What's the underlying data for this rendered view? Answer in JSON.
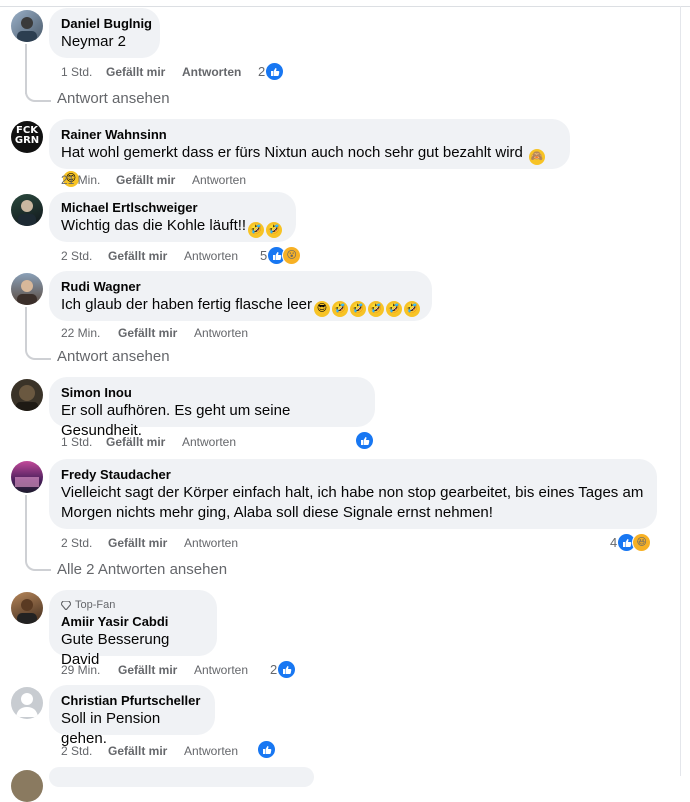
{
  "comments": [
    {
      "name": "Daniel Buglnig",
      "text": "Neymar 2",
      "time": "1 Std.",
      "like": "Gefällt mir",
      "reply": "Antworten",
      "count": "2"
    },
    {
      "name": "Rainer Wahnsinn",
      "text": "Hat wohl gemerkt dass er fürs Nixtun auch noch sehr gut bezahlt wird",
      "time": "21 Min.",
      "like": "Gefällt mir",
      "reply": "Antworten",
      "avatar_text_1": "FCK",
      "avatar_text_2": "GRN"
    },
    {
      "name": "Michael Ertlschweiger",
      "text": "Wichtig das die Kohle läuft!!",
      "time": "2 Std.",
      "like": "Gefällt mir",
      "reply": "Antworten",
      "count": "5"
    },
    {
      "name": "Rudi Wagner",
      "text": "Ich glaub der haben fertig flasche leer",
      "time": "22 Min.",
      "like": "Gefällt mir",
      "reply": "Antworten"
    },
    {
      "name": "Simon Inou",
      "text": "Er soll aufhören. Es geht um seine Gesundheit.",
      "time": "1 Std.",
      "like": "Gefällt mir",
      "reply": "Antworten"
    },
    {
      "name": "Fredy Staudacher",
      "text_line1": "Vielleicht sagt der Körper einfach halt, ich habe non stop gearbeitet, bis eines Tages am",
      "text_line2": "Morgen nichts mehr ging, Alaba soll diese Signale ernst nehmen!",
      "time": "2 Std.",
      "like": "Gefällt mir",
      "reply": "Antworten",
      "count": "4"
    },
    {
      "badge": "Top-Fan",
      "name": "Amiir Yasir Cabdi",
      "text": "Gute Besserung David",
      "time": "29 Min.",
      "like": "Gefällt mir",
      "reply": "Antworten",
      "count": "2"
    },
    {
      "name": "Christian Pfurtscheller",
      "text": "Soll in Pension gehen.",
      "time": "2 Std.",
      "like": "Gefällt mir",
      "reply": "Antworten"
    }
  ],
  "view_replies": [
    "Antwort ansehen",
    "Antwort ansehen",
    "Alle 2 Antworten ansehen"
  ],
  "colors": {
    "like_blue": "#1877f2",
    "bubble": "#f0f2f5",
    "meta_gray": "#65676b"
  }
}
